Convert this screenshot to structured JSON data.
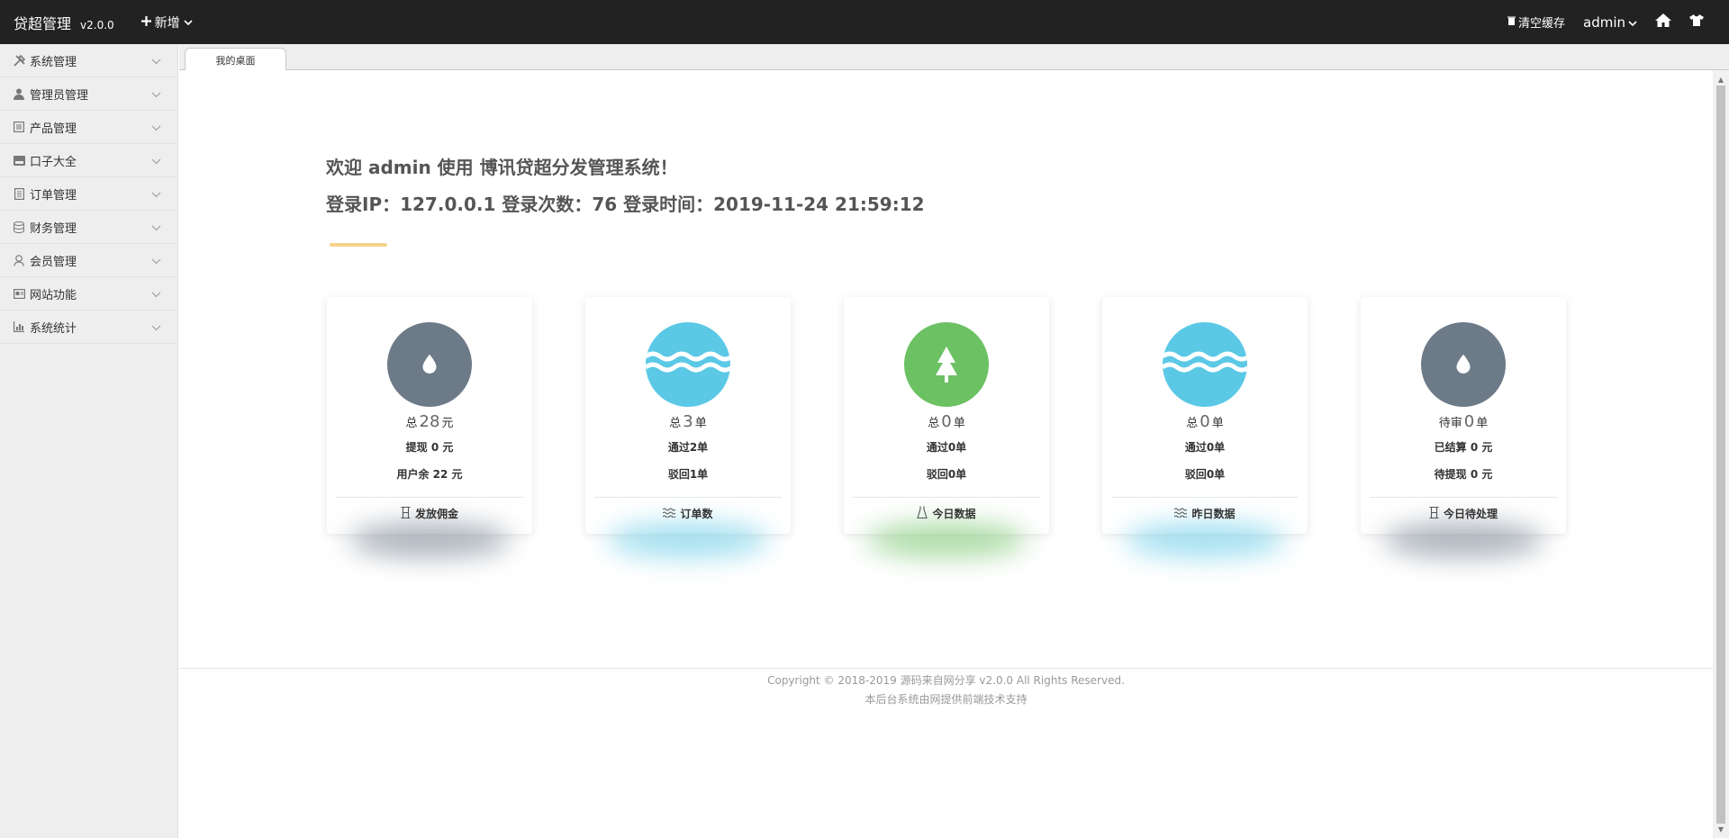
{
  "topbar": {
    "brand": "贷超管理",
    "version": "v2.0.0",
    "new_label": "新增",
    "clear_cache": "清空缓存",
    "user": "admin"
  },
  "sidebar": {
    "items": [
      {
        "label": "系统管理",
        "icon": "wrench-icon"
      },
      {
        "label": "管理员管理",
        "icon": "user-icon"
      },
      {
        "label": "产品管理",
        "icon": "product-icon"
      },
      {
        "label": "口子大全",
        "icon": "card-icon"
      },
      {
        "label": "订单管理",
        "icon": "order-icon"
      },
      {
        "label": "财务管理",
        "icon": "database-icon"
      },
      {
        "label": "会员管理",
        "icon": "member-icon"
      },
      {
        "label": "网站功能",
        "icon": "website-icon"
      },
      {
        "label": "系统统计",
        "icon": "chart-icon"
      }
    ]
  },
  "tabs": [
    {
      "label": "我的桌面"
    }
  ],
  "welcome": {
    "line1": "欢迎 admin 使用 博讯贷超分发管理系统！",
    "line2": "登录IP：127.0.0.1 登录次数：76 登录时间：2019-11-24 21:59:12"
  },
  "cards": [
    {
      "icon": "drop-icon",
      "color": "#6d7a88",
      "l1_prefix": "总",
      "l1_value": "28",
      "l1_suffix": "元",
      "l2": "提现 0 元",
      "l3": "用户余 22 元",
      "footer": "发放佣金",
      "footer_icon": "column-icon"
    },
    {
      "icon": "water-icon",
      "color": "#5bc8e6",
      "l1_prefix": "总",
      "l1_value": "3",
      "l1_suffix": "单",
      "l2": "通过2单",
      "l3": "驳回1单",
      "footer": "订单数",
      "footer_icon": "wave-icon"
    },
    {
      "icon": "tree-icon",
      "color": "#6cc162",
      "l1_prefix": "总",
      "l1_value": "0",
      "l1_suffix": "单",
      "l2": "通过0单",
      "l3": "驳回0单",
      "footer": "今日数据",
      "footer_icon": "dress-icon"
    },
    {
      "icon": "water-icon",
      "color": "#5bc8e6",
      "l1_prefix": "总",
      "l1_value": "0",
      "l1_suffix": "单",
      "l2": "通过0单",
      "l3": "驳回0单",
      "footer": "昨日数据",
      "footer_icon": "wave-icon"
    },
    {
      "icon": "drop-icon",
      "color": "#6d7a88",
      "l1_prefix": "待审",
      "l1_value": "0",
      "l1_suffix": "单",
      "l2": "已结算 0 元",
      "l3": "待提现 0 元",
      "footer": "今日待处理",
      "footer_icon": "column-icon"
    }
  ],
  "footer": {
    "copyright": "Copyright © 2018-2019 源码来自网分享 v2.0.0 All Rights Reserved.",
    "support": "本后台系统由网提供前端技术支持"
  }
}
